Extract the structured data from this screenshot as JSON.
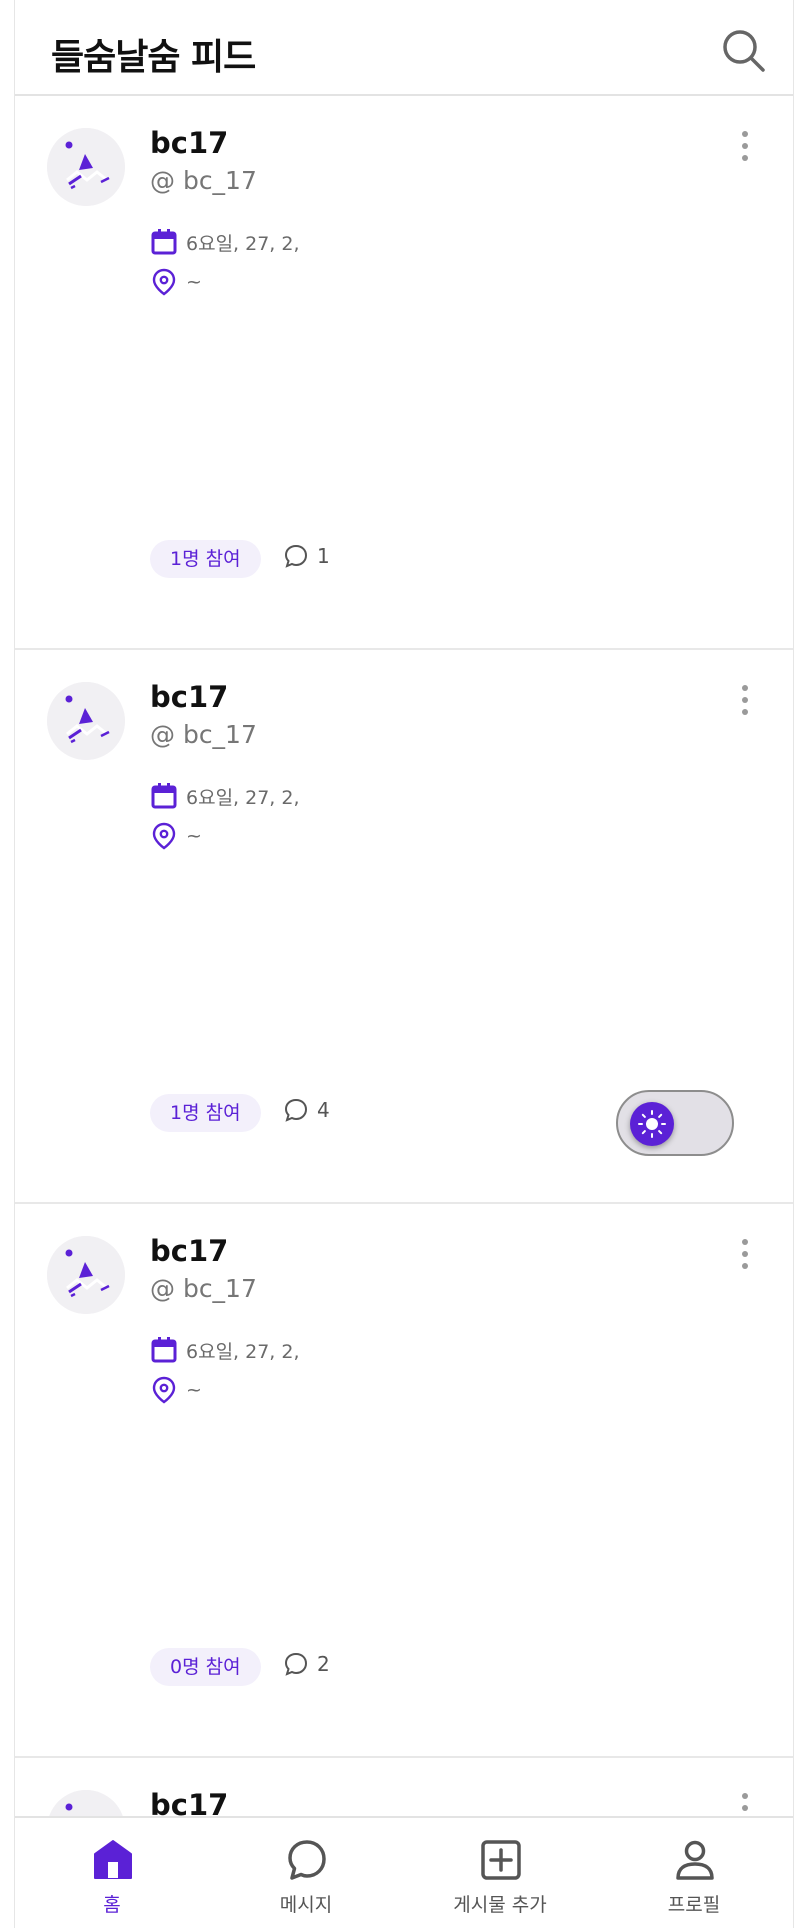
{
  "header": {
    "title": "들숨날숨 피드"
  },
  "colors": {
    "accent": "#5b21d6",
    "chip_bg": "#f3f0fb",
    "muted": "#767676"
  },
  "posts": [
    {
      "name": "bc17",
      "handle": "@ bc_17",
      "date": "6요일, 27, 2,",
      "location": "~",
      "participants": "1명 참여",
      "comments": "1"
    },
    {
      "name": "bc17",
      "handle": "@ bc_17",
      "date": "6요일, 27, 2,",
      "location": "~",
      "participants": "1명 참여",
      "comments": "4"
    },
    {
      "name": "bc17",
      "handle": "@ bc_17",
      "date": "6요일, 27, 2,",
      "location": "~",
      "participants": "0명 참여",
      "comments": "2"
    },
    {
      "name": "bc17"
    }
  ],
  "theme_toggle": {
    "icon": "sun-icon",
    "state": "light"
  },
  "nav": [
    {
      "label": "홈",
      "icon": "home-icon",
      "active": true
    },
    {
      "label": "메시지",
      "icon": "chat-bubble-icon",
      "active": false
    },
    {
      "label": "게시물 추가",
      "icon": "add-square-icon",
      "active": false
    },
    {
      "label": "프로필",
      "icon": "person-icon",
      "active": false
    }
  ]
}
